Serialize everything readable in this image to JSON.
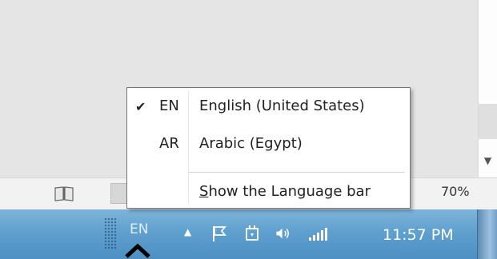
{
  "taskbar": {
    "language_indicator": "EN",
    "clock": "11:57 PM",
    "tray_icons": [
      "show-hidden-icons-arrow",
      "flag-icon",
      "power-plug-icon",
      "speaker-icon",
      "network-signal-icon"
    ]
  },
  "status_bar": {
    "zoom_minus": "-",
    "zoom_level": "70%"
  },
  "language_menu": {
    "items": [
      {
        "code": "EN",
        "label": "English (United States)",
        "checked": true,
        "check_glyph": "✔"
      },
      {
        "code": "AR",
        "label": "Arabic (Egypt)",
        "checked": false,
        "check_glyph": ""
      }
    ],
    "show_bar": {
      "access_key": "S",
      "rest": "how the Language bar"
    }
  },
  "colors": {
    "taskbar_top": "#7fb4d9",
    "taskbar_bottom": "#4d8fc2",
    "menu_border": "#767676"
  }
}
